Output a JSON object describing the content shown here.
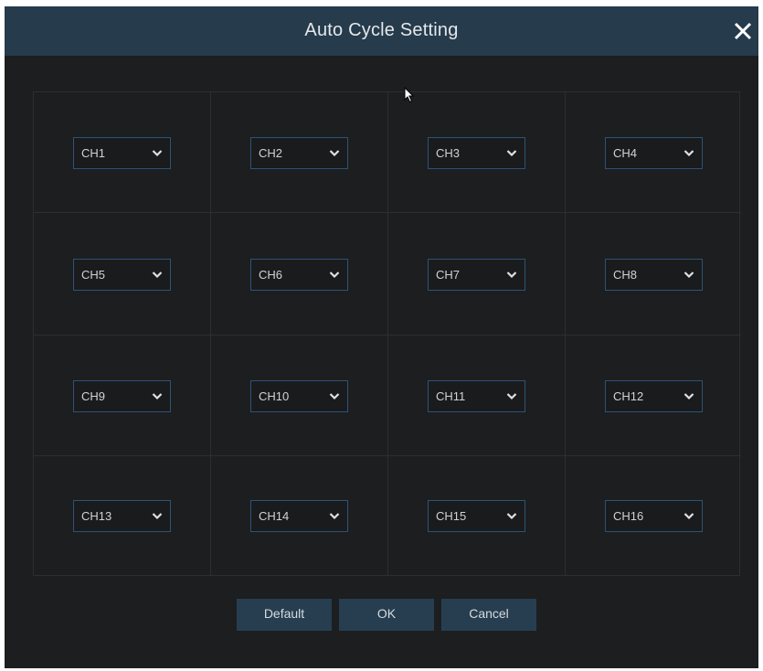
{
  "dialog": {
    "title": "Auto Cycle Setting",
    "close_icon": "close-icon"
  },
  "channels": [
    {
      "label": "CH1"
    },
    {
      "label": "CH2"
    },
    {
      "label": "CH3"
    },
    {
      "label": "CH4"
    },
    {
      "label": "CH5"
    },
    {
      "label": "CH6"
    },
    {
      "label": "CH7"
    },
    {
      "label": "CH8"
    },
    {
      "label": "CH9"
    },
    {
      "label": "CH10"
    },
    {
      "label": "CH11"
    },
    {
      "label": "CH12"
    },
    {
      "label": "CH13"
    },
    {
      "label": "CH14"
    },
    {
      "label": "CH15"
    },
    {
      "label": "CH16"
    }
  ],
  "buttons": {
    "default_label": "Default",
    "ok_label": "OK",
    "cancel_label": "Cancel"
  },
  "colors": {
    "title_bar": "#263b4b",
    "dialog_bg": "#1d1e20",
    "accent_border": "#2c5376",
    "button_bg": "#273e51"
  }
}
